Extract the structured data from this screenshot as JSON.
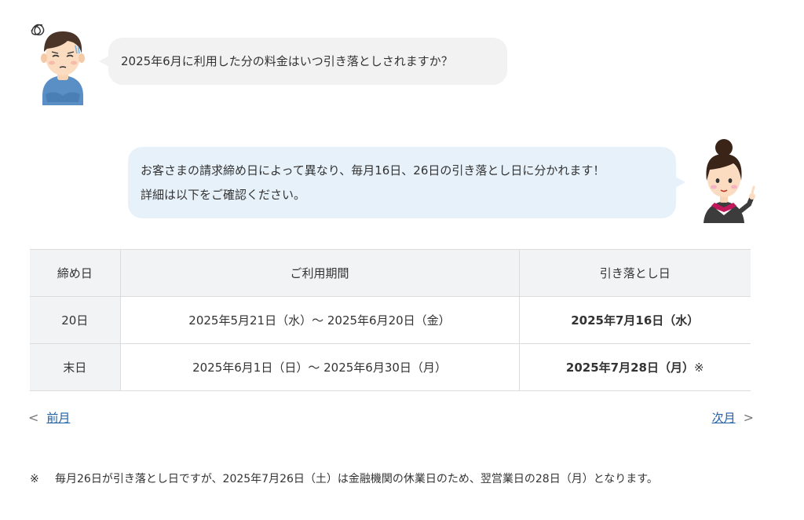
{
  "question": {
    "text": "2025年6月に利用した分の料金はいつ引き落としされますか？"
  },
  "answer": {
    "line1": "お客さまの請求締め日によって異なり、毎月16日、26日の引き落とし日に分かれます！",
    "line2": "詳細は以下をご確認ください。"
  },
  "table": {
    "headers": [
      "締め日",
      "ご利用期間",
      "引き落とし日"
    ],
    "rows": [
      {
        "closing": "20日",
        "period": "2025年5月21日（水）～ 2025年6月20日（金）",
        "debit": "2025年7月16日（水）",
        "note": ""
      },
      {
        "closing": "末日",
        "period": "2025年6月1日（日）～ 2025年6月30日（月）",
        "debit": "2025年7月28日（月）",
        "note": "※"
      }
    ]
  },
  "nav": {
    "prev_label": "前月",
    "next_label": "次月",
    "prev_icon": "chevron-left-icon",
    "next_icon": "chevron-right-icon"
  },
  "footnote": {
    "mark": "※",
    "text": "毎月26日が引き落とし日ですが、2025年7月26日（土）は金融機関の休業日のため、翌営業日の28日（月）となります。"
  },
  "colors": {
    "question_bubble": "#f2f2f2",
    "answer_bubble": "#e7f1fa",
    "table_header": "#f2f3f4",
    "link": "#1f5fa8"
  }
}
